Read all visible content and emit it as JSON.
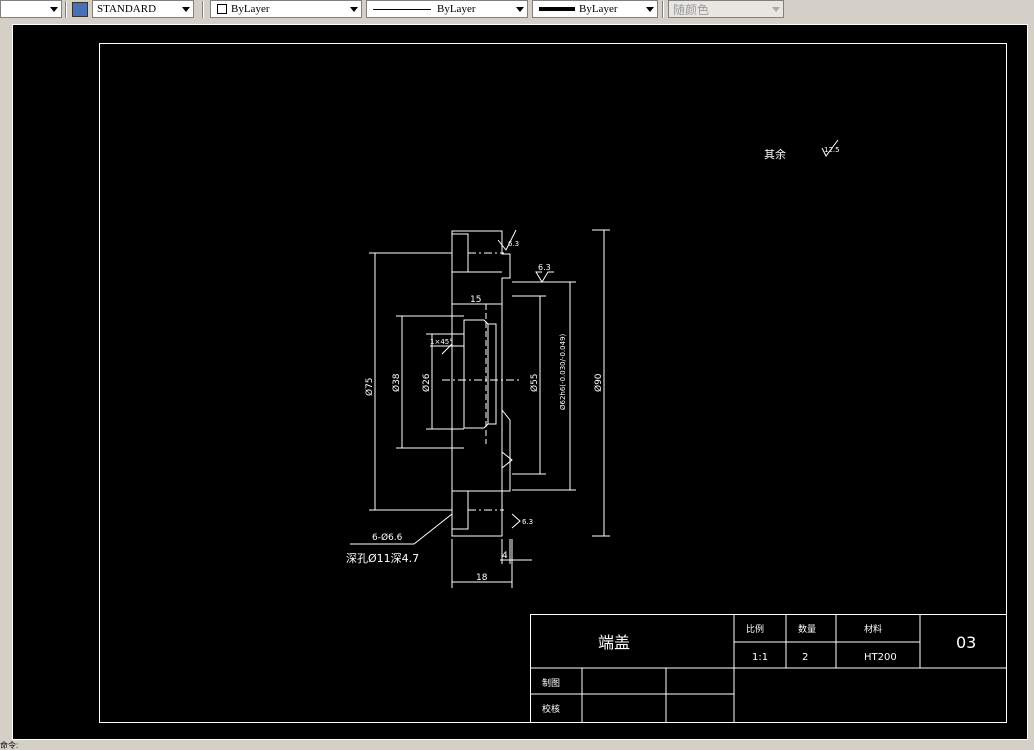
{
  "toolbar": {
    "text_style": "STANDARD",
    "layer": "ByLayer",
    "linetype": "ByLayer",
    "lineweight": "ByLayer",
    "color": "随颜色"
  },
  "drawing": {
    "surface_note": "其余",
    "surface_value": "12.5",
    "roughness_top": "6.3",
    "roughness_step": "6.3",
    "roughness_bottom": "6.3",
    "dim_15": "15",
    "dim_75": "Ø75",
    "dim_38": "Ø38",
    "dim_26": "Ø26",
    "dim_angle": "1×45°",
    "dim_55": "Ø55",
    "dim_62": "Ø62h6(-0.030/-0.049)",
    "dim_90": "Ø90",
    "hole_note": "6-Ø6.6",
    "hole_note2": "深孔Ø11深4.7",
    "dim_4": "4",
    "dim_18": "18"
  },
  "title_block": {
    "part_name": "端盖",
    "scale_label": "比例",
    "qty_label": "数量",
    "material_label": "材料",
    "scale_value": "1:1",
    "qty_value": "2",
    "material_value": "HT200",
    "drawing_no": "03",
    "drawn_label": "制图",
    "checked_label": "校核"
  },
  "status": {
    "text": "命令:"
  },
  "colors": {
    "background": "#000000",
    "lines": "#ffffff",
    "ui": "#d4d0c8"
  }
}
